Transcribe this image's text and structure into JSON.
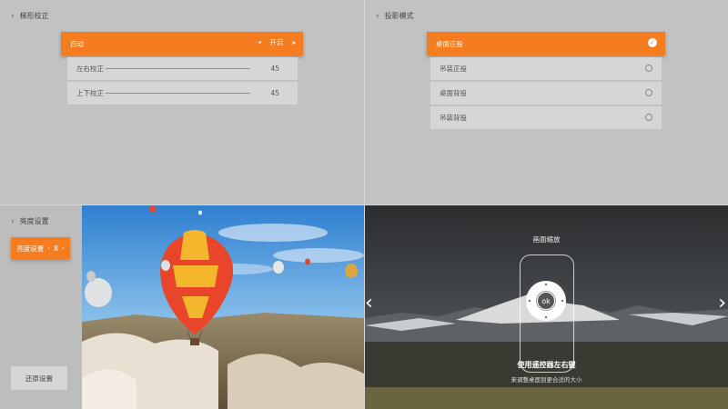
{
  "keystone": {
    "title": "梯形校正",
    "auto_label": "自动",
    "auto_value": "开启",
    "rows": [
      {
        "label": "左右校正",
        "value": "45",
        "level": 45
      },
      {
        "label": "上下校正",
        "value": "45",
        "level": 45
      }
    ]
  },
  "projection": {
    "title": "投影模式",
    "options": [
      {
        "label": "桌面正投",
        "selected": true
      },
      {
        "label": "吊装正投",
        "selected": false
      },
      {
        "label": "桌面背投",
        "selected": false
      },
      {
        "label": "吊装背投",
        "selected": false
      }
    ]
  },
  "brightness": {
    "title": "亮度设置",
    "button_label": "亮度设置",
    "value": "8",
    "reset_label": "还原设置"
  },
  "zoom": {
    "title": "画面缩放",
    "ok_label": "ok",
    "hint_main": "使用遥控器左右键",
    "hint_sub": "来调整桌面到更合适的大小"
  },
  "icons": {
    "back": "chevron-left-icon",
    "check": "check-circle-icon",
    "prev": "chevron-left-icon",
    "next": "chevron-right-icon"
  },
  "colors": {
    "accent": "#f57c1f",
    "panel": "#c2c2c2",
    "row": "#d6d6d6"
  }
}
